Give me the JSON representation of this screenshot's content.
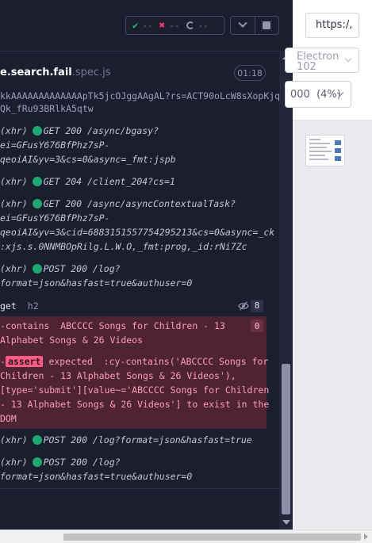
{
  "header": {
    "passed": "--",
    "failed": "--",
    "pending": "--"
  },
  "spec": {
    "name": "e.search.fail",
    "ext": ".spec.js",
    "duration": "01:18"
  },
  "log": {
    "lines": [
      {
        "text": "kkAAAAAAAAAAAAApTk5jcOJggAAgAL?rs=ACT90oLcW8sXopKjq",
        "faded": true
      },
      {
        "text": "Qk_fRu93BRlkA5qtw",
        "faded": true
      },
      {
        "text": "GET 200 /async/bgasy?"
      },
      {
        "text": "ei=GFusY676BfPhz7sP-"
      },
      {
        "text": "qeoiAI&yv=3&cs=0&async=_fmt:jspb"
      },
      {
        "text": "GET 204 /client_204?cs=1"
      },
      {
        "text": "GET 200 /async/asyncContextualTask?"
      },
      {
        "text": "ei=GFusY676BfPhz7sP-"
      },
      {
        "text": "qeoiAI&yv=3&cid=6883151557754295213&cs=0&async=_ck"
      },
      {
        "text": ":xjs.s.0NNMBOpRilg.L.W.O,_fmt:prog,_id:rNi7Zc"
      },
      {
        "text": "POST 200 /log?"
      },
      {
        "text": "format=json&hasfast=true&authuser=0"
      }
    ],
    "xhr_label": "(xhr)",
    "get_label": "get",
    "get_selector": "h2",
    "get_count": "8",
    "contains_line1": "-contains  ABCCCC Songs for Children - 13",
    "contains_line2": "Alphabet Songs & 26 Videos",
    "contains_count": "0",
    "assert_label": "assert",
    "assert_lines": [
      " expected  :cy-contains('ABCCCC Songs for",
      "Children - 13 Alphabet Songs & 26 Videos'),",
      "[type='submit'][value~='ABCCCC Songs for Children",
      "- 13 Alphabet Songs & 26 Videos'] to exist in the",
      "DOM"
    ],
    "after_lines": [
      "POST 200 /log?format=json&hasfast=true",
      "POST 200 /log?",
      "format=json&hasfast=true&authuser=0"
    ]
  },
  "aut": {
    "url": "https:/,",
    "browser": "Electron\n102",
    "zoom": "000  (4%)"
  },
  "colors": {
    "accent_pass": "#1fa971",
    "accent_fail": "#ff5b84",
    "panel_bg": "#1b1e2e"
  }
}
